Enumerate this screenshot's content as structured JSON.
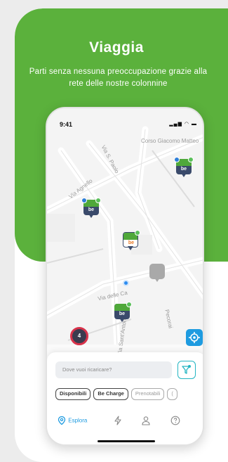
{
  "hero": {
    "title": "Viaggia",
    "subtitle": "Parti senza nessuna preoccupazione grazie alla rete delle nostre colonnine"
  },
  "phone": {
    "status_time": "9:41",
    "map": {
      "streets": [
        "Corso Giacomo Matteo",
        "Via S. Paolo",
        "Via Agnello",
        "Via delle Ca",
        "Pecorai",
        "Via Sant'Antonio"
      ],
      "cluster_count": "4",
      "pins": [
        {
          "name": "charger-pin-1",
          "logo": "be"
        },
        {
          "name": "charger-pin-2",
          "logo": "be"
        },
        {
          "name": "charger-pin-3",
          "logo": "be"
        },
        {
          "name": "charger-pin-4",
          "logo": "be"
        }
      ]
    },
    "search": {
      "placeholder": "Dove vuoi ricaricare?"
    },
    "chips": [
      "Disponibili",
      "Be Charge",
      "Prenotabili",
      "("
    ],
    "nav": {
      "explore_label": "Esplora"
    }
  },
  "colors": {
    "brand_green": "#5bb13c",
    "accent_blue": "#1e9be0",
    "pin_navy": "#3a4a6b",
    "filter_teal": "#23b5c2"
  }
}
